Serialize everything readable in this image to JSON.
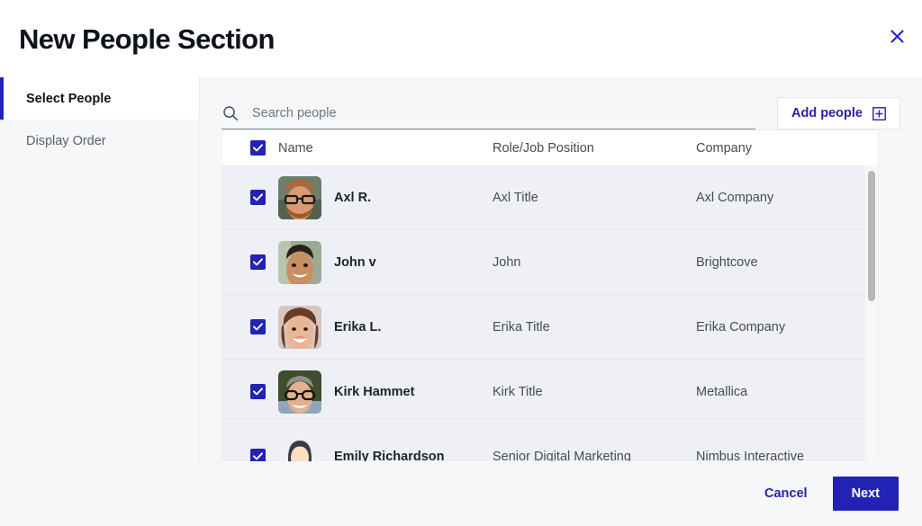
{
  "header": {
    "title": "New People Section",
    "close_icon": "close-icon"
  },
  "sidebar": {
    "items": [
      {
        "label": "Select People",
        "active": true
      },
      {
        "label": "Display Order",
        "active": false
      }
    ]
  },
  "toolbar": {
    "search_placeholder": "Search people",
    "search_value": "",
    "search_icon": "search-icon",
    "add_people_label": "Add people",
    "add_people_icon": "plus-square-icon"
  },
  "table": {
    "select_all_checked": true,
    "columns": [
      "Name",
      "Role/Job Position",
      "Company"
    ],
    "rows": [
      {
        "checked": true,
        "name": "Axl R.",
        "role": "Axl Title",
        "company": "Axl Company",
        "avatar": "photo-bearded-man-glasses"
      },
      {
        "checked": true,
        "name": "John v",
        "role": "John",
        "company": "Brightcove",
        "avatar": "photo-young-man-smiling"
      },
      {
        "checked": true,
        "name": "Erika L.",
        "role": "Erika Title",
        "company": "Erika Company",
        "avatar": "photo-woman-smiling"
      },
      {
        "checked": true,
        "name": "Kirk Hammet",
        "role": "Kirk Title",
        "company": "Metallica",
        "avatar": "photo-man-glasses-outdoors"
      },
      {
        "checked": true,
        "name": "Emily Richardson",
        "role": "Senior Digital Marketing",
        "company": "Nimbus Interactive",
        "avatar": "illustration-woman-dark-hair"
      }
    ]
  },
  "footer": {
    "cancel_label": "Cancel",
    "next_label": "Next"
  },
  "colors": {
    "accent": "#2222b5",
    "link": "#2a21a8",
    "row_bg": "#eff0f5",
    "panel_bg": "#f6f7f8",
    "text": "#0d121c"
  }
}
